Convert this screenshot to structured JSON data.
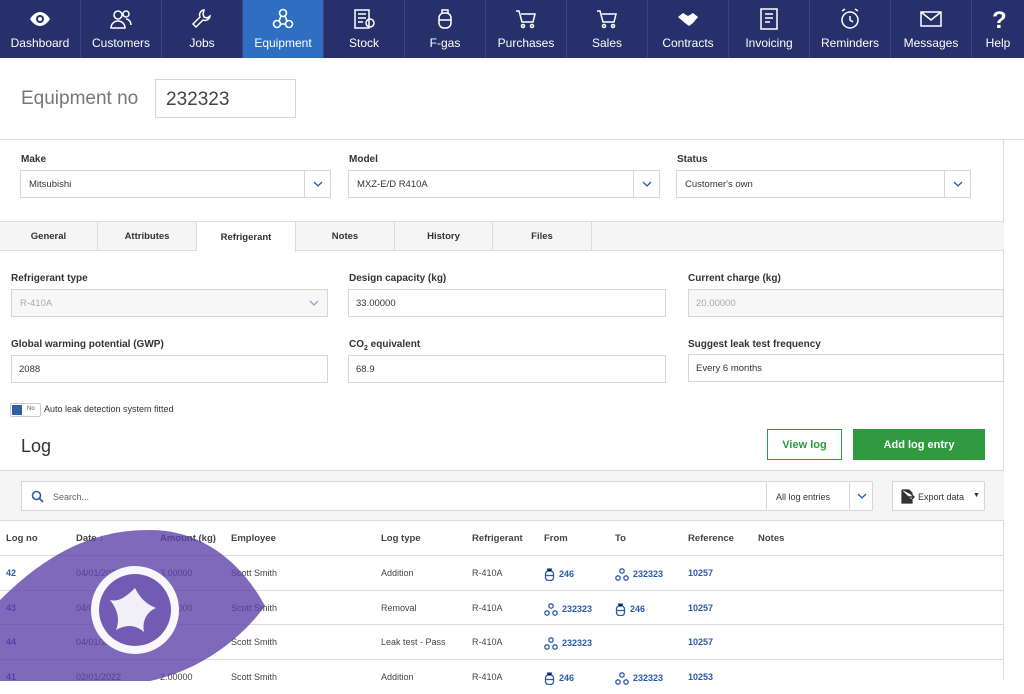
{
  "nav": {
    "items": [
      {
        "label": "Dashboard",
        "icon": "eye-icon"
      },
      {
        "label": "Customers",
        "icon": "people-icon"
      },
      {
        "label": "Jobs",
        "icon": "wrench-icon"
      },
      {
        "label": "Equipment",
        "icon": "equipment-icon"
      },
      {
        "label": "Stock",
        "icon": "stock-icon"
      },
      {
        "label": "F-gas",
        "icon": "gas-cylinder-icon"
      },
      {
        "label": "Purchases",
        "icon": "cart-icon"
      },
      {
        "label": "Sales",
        "icon": "cart-icon"
      },
      {
        "label": "Contracts",
        "icon": "handshake-icon"
      },
      {
        "label": "Invoicing",
        "icon": "invoice-icon"
      },
      {
        "label": "Reminders",
        "icon": "alarm-clock-icon"
      },
      {
        "label": "Messages",
        "icon": "envelope-icon"
      },
      {
        "label": "Help",
        "icon": "question-icon"
      }
    ],
    "active": "Equipment",
    "colors": {
      "bar": "#27306b",
      "active": "#2f6fc1"
    }
  },
  "header": {
    "label": "Equipment no",
    "value": "232323"
  },
  "fields": {
    "make": {
      "label": "Make",
      "value": "Mitsubishi"
    },
    "model": {
      "label": "Model",
      "value": "MXZ-E/D R410A"
    },
    "status": {
      "label": "Status",
      "value": "Customer's own"
    }
  },
  "tabs": [
    "General",
    "Attributes",
    "Refrigerant",
    "Notes",
    "History",
    "Files"
  ],
  "active_tab": "Refrigerant",
  "refrigerant": {
    "type": {
      "label": "Refrigerant type",
      "value": "R-410A"
    },
    "design_capacity": {
      "label": "Design capacity (kg)",
      "value": "33.00000"
    },
    "current_charge": {
      "label": "Current charge (kg)",
      "value": "20.00000"
    },
    "gwp": {
      "label": "Global warming potential (GWP)",
      "value": "2088"
    },
    "co2": {
      "label_prefix": "CO",
      "label_sub": "2",
      "label_suffix": " equivalent",
      "value": "68.9"
    },
    "leak_freq": {
      "label": "Suggest leak test frequency",
      "value": "Every 6 months"
    },
    "auto_leak": {
      "state": "No",
      "label": "Auto leak detection system fitted"
    }
  },
  "log": {
    "title": "Log",
    "view_button": "View log",
    "add_button": "Add log entry",
    "search_placeholder": "Search...",
    "filter": "All log entries",
    "export": "Export data",
    "columns": [
      "Log no",
      "Date ↓",
      "Amount (kg)",
      "Employee",
      "Log type",
      "Refrigerant",
      "From",
      "To",
      "Reference",
      "Notes"
    ],
    "rows": [
      {
        "log_no": "42",
        "date": "04/01/2022",
        "amount": "3.00000",
        "employee": "Scott Smith",
        "type": "Addition",
        "refrigerant": "R-410A",
        "from": "246",
        "from_icon": "cylinder",
        "to": "232323",
        "to_icon": "equipment",
        "reference": "10257"
      },
      {
        "log_no": "43",
        "date": "04/01/2022",
        "amount": "2.00000",
        "employee": "Scott Smith",
        "type": "Removal",
        "refrigerant": "R-410A",
        "from": "232323",
        "from_icon": "equipment",
        "to": "246",
        "to_icon": "cylinder",
        "reference": "10257"
      },
      {
        "log_no": "44",
        "date": "04/01/2022",
        "amount": "",
        "employee": "Scott Smith",
        "type": "Leak test - Pass",
        "refrigerant": "R-410A",
        "from": "232323",
        "from_icon": "equipment",
        "to": "",
        "to_icon": "",
        "reference": "10257"
      },
      {
        "log_no": "41",
        "date": "02/01/2022",
        "amount": "2.00000",
        "employee": "Scott Smith",
        "type": "Addition",
        "refrigerant": "R-410A",
        "from": "246",
        "from_icon": "cylinder",
        "to": "232323",
        "to_icon": "equipment",
        "reference": "10253"
      }
    ]
  },
  "colors": {
    "link": "#2a5aa8",
    "green": "#2f9a3f",
    "watermark": "#5b3fa6"
  }
}
